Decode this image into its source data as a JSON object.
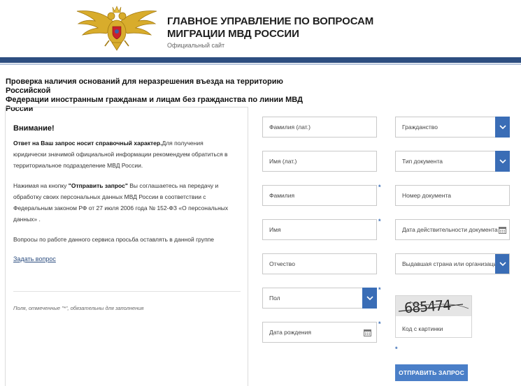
{
  "header": {
    "title_line1": "ГЛАВНОЕ УПРАВЛЕНИЕ ПО ВОПРОСАМ",
    "title_line2": "МИГРАЦИИ МВД РОССИИ",
    "subtitle": "Официальный сайт"
  },
  "page": {
    "heading_line1": "Проверка наличия оснований для неразрешения въезда на территорию Российской",
    "heading_line2": "Федерации иностранным гражданам и лицам без гражданства по линии МВД России"
  },
  "info": {
    "title": "Внимание!",
    "p1_bold": "Ответ на Ваш запрос носит справочный характер.",
    "p1_rest": "Для получения юридически значимой официальной информации рекомендуем обратиться в территориальное подразделение МВД России.",
    "p2_pre": "Нажимая на кнопку ",
    "p2_bold": "\"Отправить запрос\"",
    "p2_rest": " Вы соглашаетесь на передачу и обработку своих персональных данных МВД России в соответствии с Федеральным законом РФ от 27 июля 2006 года № 152-ФЗ «О персональных данных» .",
    "p3": "Вопросы по работе данного сервиса просьба оставлять в данной группе",
    "ask_link": "Задать вопрос",
    "required_note": "Поля, отмеченные \"*\", обязательны для заполнения"
  },
  "form": {
    "surname_lat": "Фамилия (лат.)",
    "name_lat": "Имя (лат.)",
    "surname": "Фамилия",
    "name": "Имя",
    "patronymic": "Отчество",
    "gender": "Пол",
    "birth_date": "Дата рождения",
    "citizenship": "Гражданство",
    "doc_type": "Тип документа",
    "doc_number": "Номер документа",
    "doc_validity": "Дата действительности документа",
    "issuing_country": "Выдавшая страна или организация",
    "captcha_text": "685474",
    "captcha_label": "Код с картинки",
    "submit_label": "ОТПРАВИТЬ ЗАПРОС",
    "required_mark": "*"
  },
  "colors": {
    "brand_dark": "#2d4e80",
    "select_button": "#3a6db6",
    "submit_button": "#4a7fc8"
  }
}
